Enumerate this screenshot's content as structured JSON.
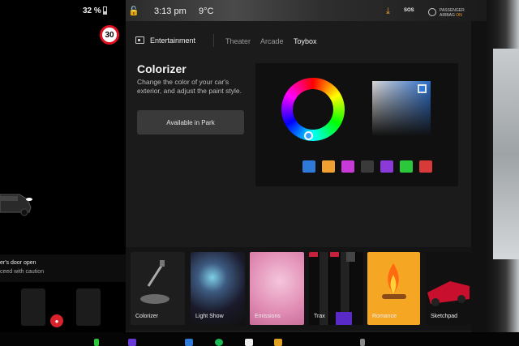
{
  "status": {
    "battery": "32 %",
    "time": "3:13 pm",
    "temperature": "9°C",
    "sos": "SOS",
    "airbag_label": "PASSENGER",
    "airbag_label2": "AIRBAG",
    "airbag_state": "ON"
  },
  "drive": {
    "speed_limit": "30",
    "alert_title": "er's door open",
    "alert_sub": "ceed with caution"
  },
  "nav": {
    "section": "Entertainment",
    "tabs": [
      {
        "label": "Theater",
        "active": false
      },
      {
        "label": "Arcade",
        "active": false
      },
      {
        "label": "Toybox",
        "active": true
      }
    ]
  },
  "feature": {
    "title": "Colorizer",
    "description": "Change the color of your car's exterior, and adjust the paint style.",
    "park_button": "Available in Park"
  },
  "swatches": [
    "#2f7ad8",
    "#f0a030",
    "#c83ad8",
    "#3a3a3a",
    "#8a3ad8",
    "#2ac83a",
    "#d83a3a"
  ],
  "apps": [
    {
      "label": "Colorizer"
    },
    {
      "label": "Light Show"
    },
    {
      "label": "Emissions"
    },
    {
      "label": "Trax"
    },
    {
      "label": "Romance"
    },
    {
      "label": "Sketchpad"
    }
  ],
  "colors": {
    "accent_orange": "#f0a030",
    "alert_red": "#d8232a",
    "selected_blue": "#2f7ad8"
  }
}
